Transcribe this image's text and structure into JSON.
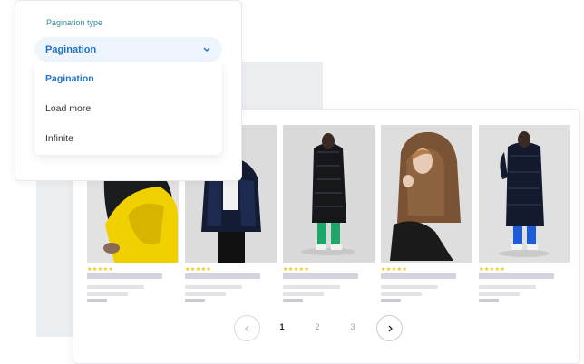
{
  "dropdown": {
    "label": "Pagination type",
    "selected": "Pagination",
    "options": [
      "Pagination",
      "Load more",
      "Infinite"
    ]
  },
  "products": [
    {
      "rating": "★★★★★",
      "image": "model-leaning-yellow-chair"
    },
    {
      "rating": "★★★★★",
      "image": "model-navy-puffer-jacket"
    },
    {
      "rating": "★★★★★",
      "image": "model-long-black-puffer-green-pants"
    },
    {
      "rating": "★★★★★",
      "image": "model-brown-hooded-puffer-crouching"
    },
    {
      "rating": "★★★★★",
      "image": "model-long-navy-puffer-blue-pants"
    }
  ],
  "pagination": {
    "pages": [
      "1",
      "2",
      "3"
    ],
    "current": "1"
  },
  "colors": {
    "accent": "#1f73c8",
    "label": "#2d8c99",
    "star": "#f2c300",
    "background_block": "#eceff1"
  }
}
